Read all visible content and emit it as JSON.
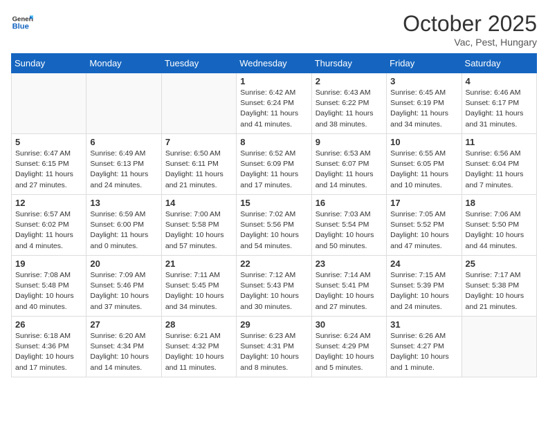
{
  "header": {
    "logo_general": "General",
    "logo_blue": "Blue",
    "month": "October 2025",
    "location": "Vac, Pest, Hungary"
  },
  "days_of_week": [
    "Sunday",
    "Monday",
    "Tuesday",
    "Wednesday",
    "Thursday",
    "Friday",
    "Saturday"
  ],
  "weeks": [
    [
      {
        "day": "",
        "info": ""
      },
      {
        "day": "",
        "info": ""
      },
      {
        "day": "",
        "info": ""
      },
      {
        "day": "1",
        "info": "Sunrise: 6:42 AM\nSunset: 6:24 PM\nDaylight: 11 hours\nand 41 minutes."
      },
      {
        "day": "2",
        "info": "Sunrise: 6:43 AM\nSunset: 6:22 PM\nDaylight: 11 hours\nand 38 minutes."
      },
      {
        "day": "3",
        "info": "Sunrise: 6:45 AM\nSunset: 6:19 PM\nDaylight: 11 hours\nand 34 minutes."
      },
      {
        "day": "4",
        "info": "Sunrise: 6:46 AM\nSunset: 6:17 PM\nDaylight: 11 hours\nand 31 minutes."
      }
    ],
    [
      {
        "day": "5",
        "info": "Sunrise: 6:47 AM\nSunset: 6:15 PM\nDaylight: 11 hours\nand 27 minutes."
      },
      {
        "day": "6",
        "info": "Sunrise: 6:49 AM\nSunset: 6:13 PM\nDaylight: 11 hours\nand 24 minutes."
      },
      {
        "day": "7",
        "info": "Sunrise: 6:50 AM\nSunset: 6:11 PM\nDaylight: 11 hours\nand 21 minutes."
      },
      {
        "day": "8",
        "info": "Sunrise: 6:52 AM\nSunset: 6:09 PM\nDaylight: 11 hours\nand 17 minutes."
      },
      {
        "day": "9",
        "info": "Sunrise: 6:53 AM\nSunset: 6:07 PM\nDaylight: 11 hours\nand 14 minutes."
      },
      {
        "day": "10",
        "info": "Sunrise: 6:55 AM\nSunset: 6:05 PM\nDaylight: 11 hours\nand 10 minutes."
      },
      {
        "day": "11",
        "info": "Sunrise: 6:56 AM\nSunset: 6:04 PM\nDaylight: 11 hours\nand 7 minutes."
      }
    ],
    [
      {
        "day": "12",
        "info": "Sunrise: 6:57 AM\nSunset: 6:02 PM\nDaylight: 11 hours\nand 4 minutes."
      },
      {
        "day": "13",
        "info": "Sunrise: 6:59 AM\nSunset: 6:00 PM\nDaylight: 11 hours\nand 0 minutes."
      },
      {
        "day": "14",
        "info": "Sunrise: 7:00 AM\nSunset: 5:58 PM\nDaylight: 10 hours\nand 57 minutes."
      },
      {
        "day": "15",
        "info": "Sunrise: 7:02 AM\nSunset: 5:56 PM\nDaylight: 10 hours\nand 54 minutes."
      },
      {
        "day": "16",
        "info": "Sunrise: 7:03 AM\nSunset: 5:54 PM\nDaylight: 10 hours\nand 50 minutes."
      },
      {
        "day": "17",
        "info": "Sunrise: 7:05 AM\nSunset: 5:52 PM\nDaylight: 10 hours\nand 47 minutes."
      },
      {
        "day": "18",
        "info": "Sunrise: 7:06 AM\nSunset: 5:50 PM\nDaylight: 10 hours\nand 44 minutes."
      }
    ],
    [
      {
        "day": "19",
        "info": "Sunrise: 7:08 AM\nSunset: 5:48 PM\nDaylight: 10 hours\nand 40 minutes."
      },
      {
        "day": "20",
        "info": "Sunrise: 7:09 AM\nSunset: 5:46 PM\nDaylight: 10 hours\nand 37 minutes."
      },
      {
        "day": "21",
        "info": "Sunrise: 7:11 AM\nSunset: 5:45 PM\nDaylight: 10 hours\nand 34 minutes."
      },
      {
        "day": "22",
        "info": "Sunrise: 7:12 AM\nSunset: 5:43 PM\nDaylight: 10 hours\nand 30 minutes."
      },
      {
        "day": "23",
        "info": "Sunrise: 7:14 AM\nSunset: 5:41 PM\nDaylight: 10 hours\nand 27 minutes."
      },
      {
        "day": "24",
        "info": "Sunrise: 7:15 AM\nSunset: 5:39 PM\nDaylight: 10 hours\nand 24 minutes."
      },
      {
        "day": "25",
        "info": "Sunrise: 7:17 AM\nSunset: 5:38 PM\nDaylight: 10 hours\nand 21 minutes."
      }
    ],
    [
      {
        "day": "26",
        "info": "Sunrise: 6:18 AM\nSunset: 4:36 PM\nDaylight: 10 hours\nand 17 minutes."
      },
      {
        "day": "27",
        "info": "Sunrise: 6:20 AM\nSunset: 4:34 PM\nDaylight: 10 hours\nand 14 minutes."
      },
      {
        "day": "28",
        "info": "Sunrise: 6:21 AM\nSunset: 4:32 PM\nDaylight: 10 hours\nand 11 minutes."
      },
      {
        "day": "29",
        "info": "Sunrise: 6:23 AM\nSunset: 4:31 PM\nDaylight: 10 hours\nand 8 minutes."
      },
      {
        "day": "30",
        "info": "Sunrise: 6:24 AM\nSunset: 4:29 PM\nDaylight: 10 hours\nand 5 minutes."
      },
      {
        "day": "31",
        "info": "Sunrise: 6:26 AM\nSunset: 4:27 PM\nDaylight: 10 hours\nand 1 minute."
      },
      {
        "day": "",
        "info": ""
      }
    ]
  ],
  "colors": {
    "header_bg": "#1565C0",
    "logo_blue": "#1565C0"
  }
}
